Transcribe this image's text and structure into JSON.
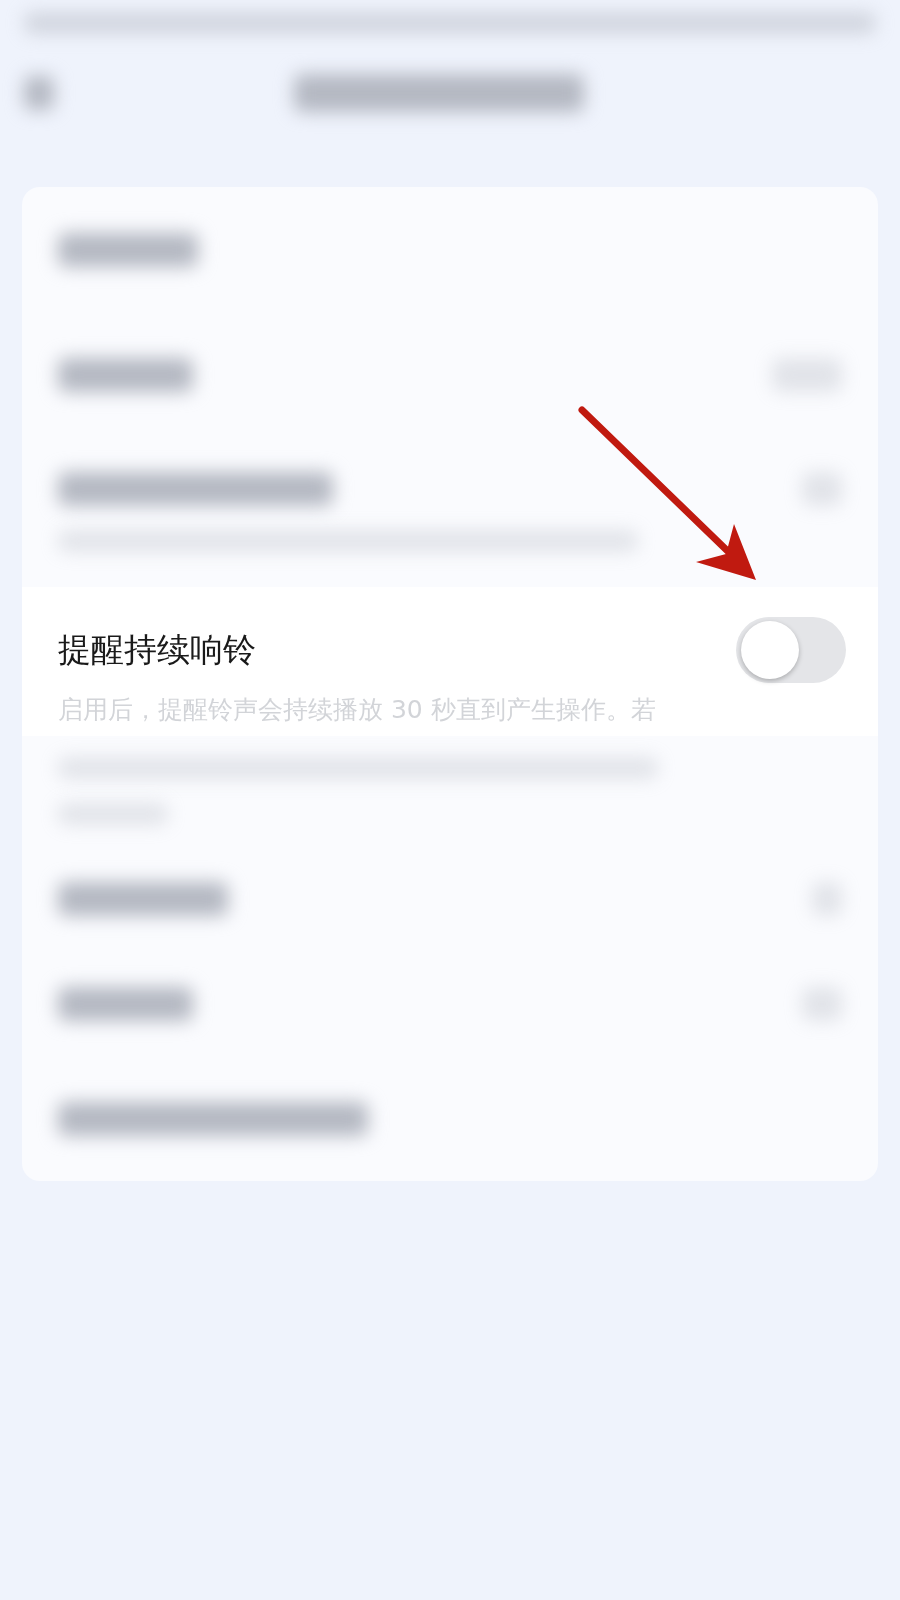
{
  "setting": {
    "title": "提醒持续响铃",
    "description": "启用后，提醒铃声会持续播放 30 秒直到产生操作。若",
    "on": false
  }
}
